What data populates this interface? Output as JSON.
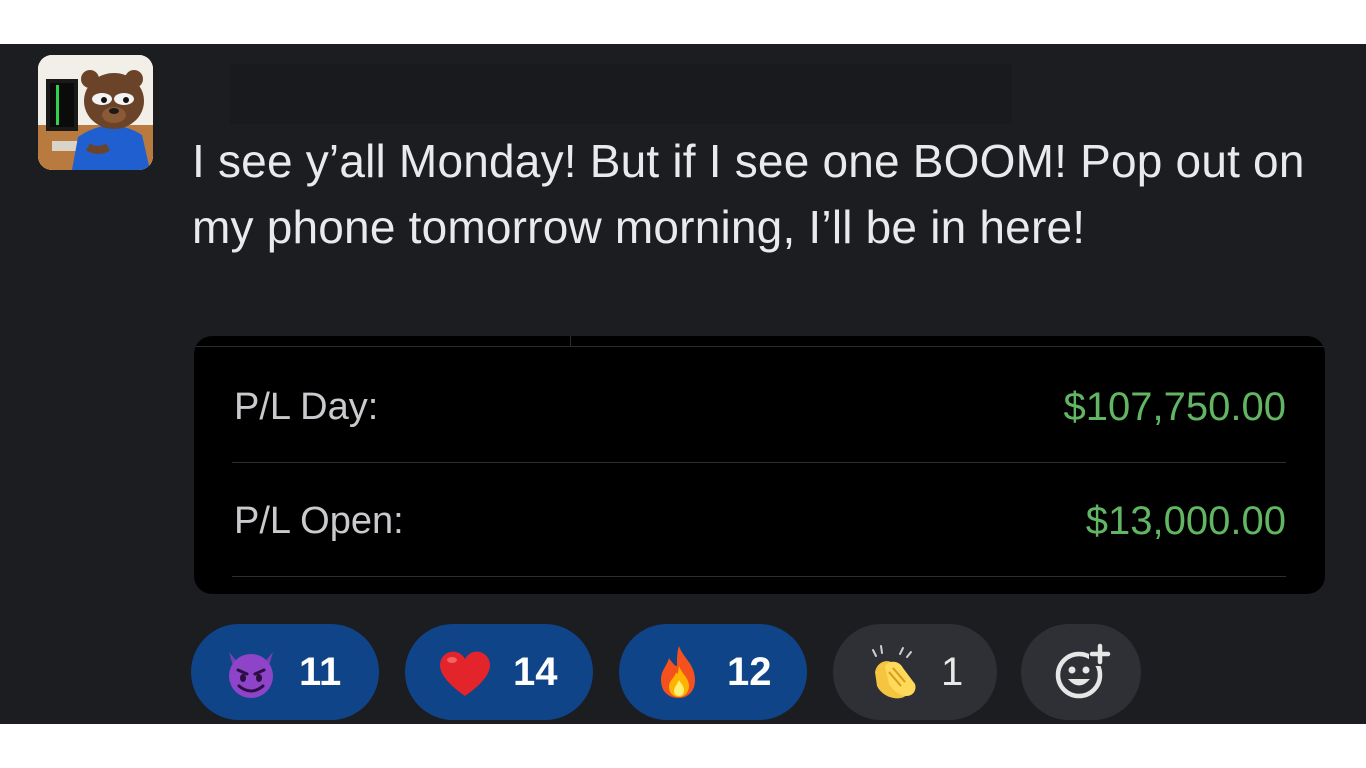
{
  "message": {
    "text": "I see y’all Monday! But if I see one BOOM! Pop out on my phone tomorrow morning, I’ll be in here!"
  },
  "pl_card": {
    "rows": [
      {
        "label": "P/L Day:",
        "value": "$107,750.00"
      },
      {
        "label": "P/L Open:",
        "value": "$13,000.00"
      }
    ],
    "value_color": "#62b562"
  },
  "reactions": [
    {
      "icon": "smiling-devil-icon",
      "count": "11",
      "active": true
    },
    {
      "icon": "red-heart-icon",
      "count": "14",
      "active": true
    },
    {
      "icon": "fire-icon",
      "count": "12",
      "active": true
    },
    {
      "icon": "clapping-hands-icon",
      "count": "1",
      "active": false
    },
    {
      "icon": "add-reaction-icon",
      "count": "",
      "active": false
    }
  ],
  "colors": {
    "background": "#1b1d21",
    "active_reaction": "#0f4489",
    "inactive_reaction": "#2e3035"
  }
}
